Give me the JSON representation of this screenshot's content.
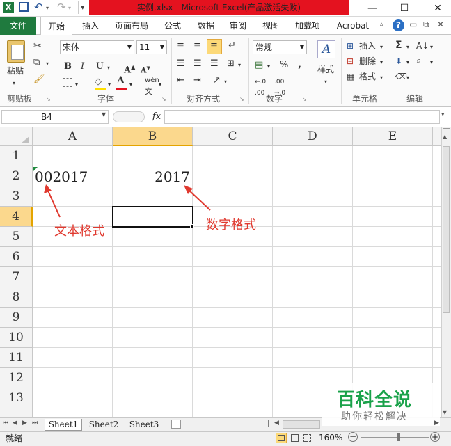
{
  "window": {
    "title": "实例.xlsx - Microsoft Excel(产品激活失败)",
    "qat": [
      "excel-logo-icon",
      "save-icon",
      "undo-icon",
      "redo-icon",
      "customize-icon"
    ],
    "controls": [
      "—",
      "☐",
      "✕"
    ]
  },
  "tabs": {
    "file": "文件",
    "items": [
      "开始",
      "插入",
      "页面布局",
      "公式",
      "数据",
      "审阅",
      "视图",
      "加载项",
      "Acrobat"
    ],
    "active": "开始"
  },
  "ribbon": {
    "clipboard": {
      "label": "剪贴板",
      "paste": "粘贴"
    },
    "font": {
      "label": "字体",
      "name": "宋体",
      "size": "11",
      "bold": "B",
      "italic": "I",
      "underline": "U",
      "wen": "wén"
    },
    "align": {
      "label": "对齐方式"
    },
    "number": {
      "label": "数字",
      "format": "常规",
      "percent": "%",
      "comma": ","
    },
    "styles": {
      "label": "样式"
    },
    "cells": {
      "label": "单元格",
      "insert": "插入",
      "delete": "删除",
      "format": "格式"
    },
    "edit": {
      "label": "编辑",
      "sum": "Σ"
    }
  },
  "formula_bar": {
    "namebox": "B4",
    "fx": "fx",
    "value": ""
  },
  "grid": {
    "columns": [
      "A",
      "B",
      "C",
      "D",
      "E"
    ],
    "rows": [
      "1",
      "2",
      "3",
      "4",
      "5",
      "6",
      "7",
      "8",
      "9",
      "10",
      "11",
      "12",
      "13"
    ],
    "selected_col": "B",
    "selected_row": "4",
    "cells": {
      "A2": "002017",
      "B2": "2017"
    }
  },
  "annotations": {
    "text_format": "文本格式",
    "number_format": "数字格式",
    "color": "#e0392f"
  },
  "sheets": {
    "names": [
      "Sheet1",
      "Sheet2",
      "Sheet3"
    ],
    "active": "Sheet1"
  },
  "status": {
    "ready": "就绪",
    "zoom": "160%"
  },
  "watermark": {
    "title": "百科全说",
    "subtitle": "助你轻松解决"
  }
}
